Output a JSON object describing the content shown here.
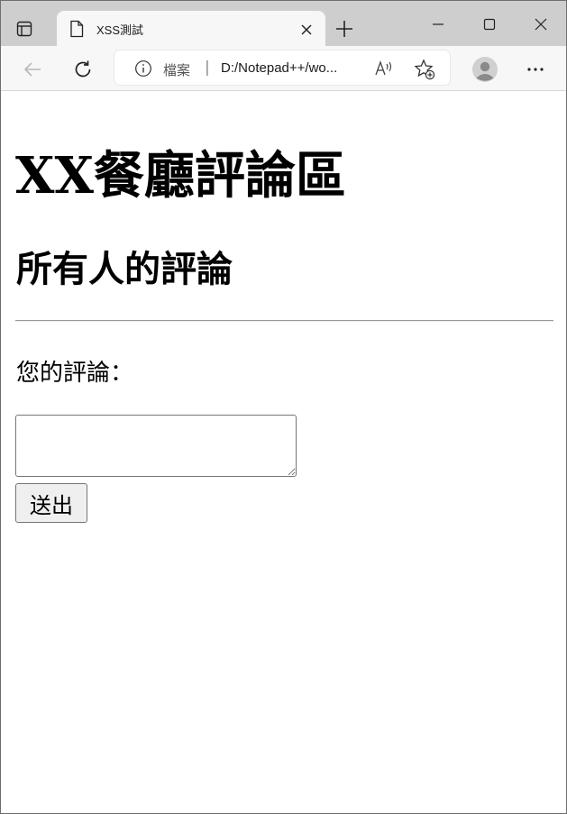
{
  "browser": {
    "tab_title": "XSS測試",
    "address": {
      "scheme_label": "檔案",
      "separator": "|",
      "url": "D:/Notepad++/wo..."
    },
    "icons": {
      "tab_actions": "tab-actions-icon",
      "document": "document-icon",
      "close_tab": "close-icon",
      "new_tab": "plus-icon",
      "minimize": "minimize-icon",
      "maximize": "maximize-icon",
      "close_window": "close-icon",
      "back": "back-arrow-icon",
      "reload": "reload-icon",
      "info": "info-icon",
      "read_aloud": "read-aloud-icon",
      "favorites": "add-favorite-icon",
      "profile": "profile-avatar-icon",
      "more": "more-options-icon"
    }
  },
  "page": {
    "title": "XX餐廳評論區",
    "subtitle": "所有人的評論",
    "comment_label": "您的評論：",
    "comment_value": "",
    "submit_label": "送出"
  }
}
